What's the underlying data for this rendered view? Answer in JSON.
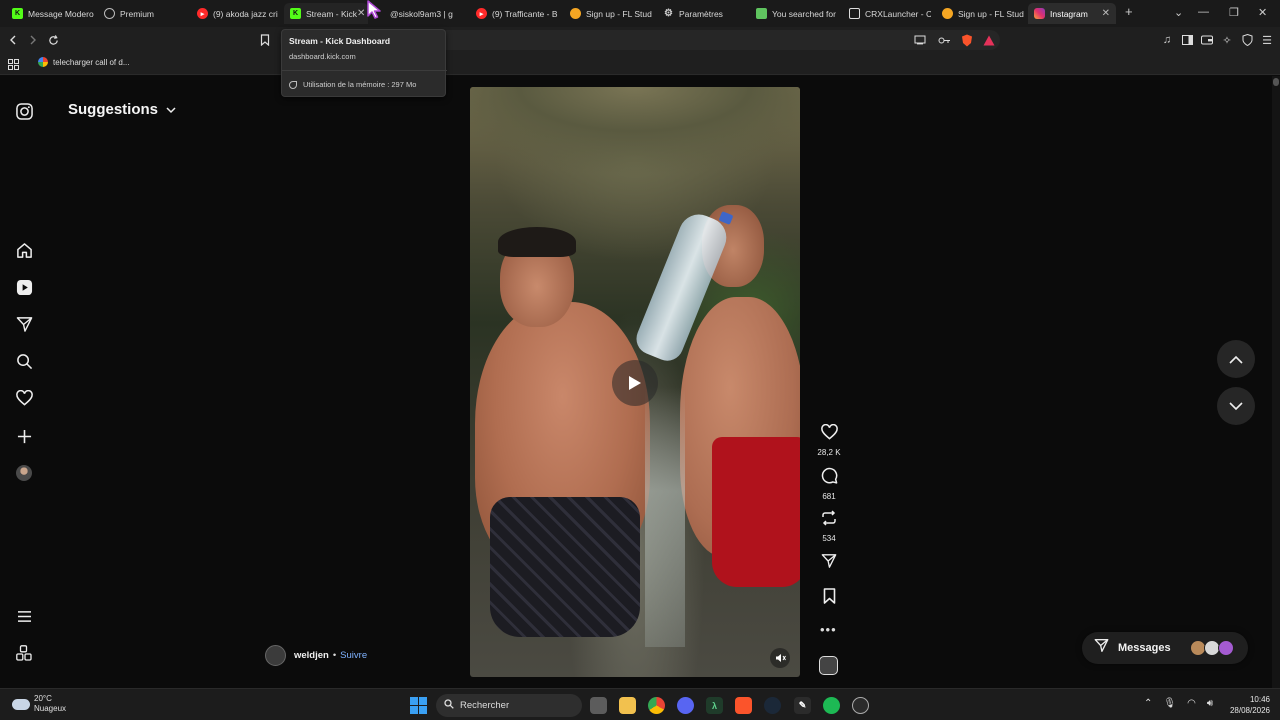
{
  "browser": {
    "tabs": [
      {
        "label": "Message Modero",
        "favicon": "kick-icon",
        "color": "#53fc18"
      },
      {
        "label": "Premium",
        "favicon": "globe-icon",
        "color": "#bbbbbb"
      },
      {
        "label": "(9) akoda jazz cri",
        "favicon": "youtube-icon",
        "color": "#ff2a2a"
      },
      {
        "label": "Stream - Kick",
        "favicon": "kick-icon",
        "color": "#53fc18"
      },
      {
        "label": "@siskol9am3 | g",
        "favicon": "globe-icon",
        "color": "#bbbbbb"
      },
      {
        "label": "(9) Trafficante - B",
        "favicon": "youtube-icon",
        "color": "#ff2a2a"
      },
      {
        "label": "Sign up - FL Stud",
        "favicon": "fl-icon",
        "color": "#f5a623"
      },
      {
        "label": "Paramètres",
        "favicon": "gear-icon",
        "color": "#cccccc"
      },
      {
        "label": "You searched for",
        "favicon": "search-result-icon",
        "color": "#5fc45f"
      },
      {
        "label": "CRXLauncher - C",
        "favicon": "window-icon",
        "color": "#dddddd"
      },
      {
        "label": "Sign up - FL Stud",
        "favicon": "fl-icon",
        "color": "#f5a623"
      },
      {
        "label": "Instagram",
        "favicon": "instagram-icon",
        "color": "#e1306c"
      }
    ],
    "url_tail": "/",
    "bookmark": {
      "label": "telecharger call of d..."
    },
    "tooltip": {
      "title": "Stream - Kick Dashboard",
      "url": "dashboard.kick.com",
      "memory": "Utilisation de la mémoire : 297 Mo"
    }
  },
  "instagram": {
    "header": "Suggestions",
    "nav_items": [
      "instagram-logo",
      "home",
      "reels",
      "send",
      "search",
      "notifications",
      "create",
      "profile",
      "menu",
      "more-apps"
    ],
    "actions": {
      "likes": "28,2 K",
      "comments": "681",
      "reposts": "534"
    },
    "author": {
      "name": "weldjen",
      "separator": "•",
      "follow": "Suivre"
    },
    "messages_label": "Messages"
  },
  "taskbar": {
    "weather_temp": "20°C",
    "weather_desc": "Nuageux",
    "search_placeholder": "Rechercher",
    "time": "10:46",
    "date": "28/08/2026"
  },
  "colors": {
    "accent_follow": "#7fb2ff",
    "kick_green": "#53fc18",
    "instagram_pink": "#e1306c"
  }
}
